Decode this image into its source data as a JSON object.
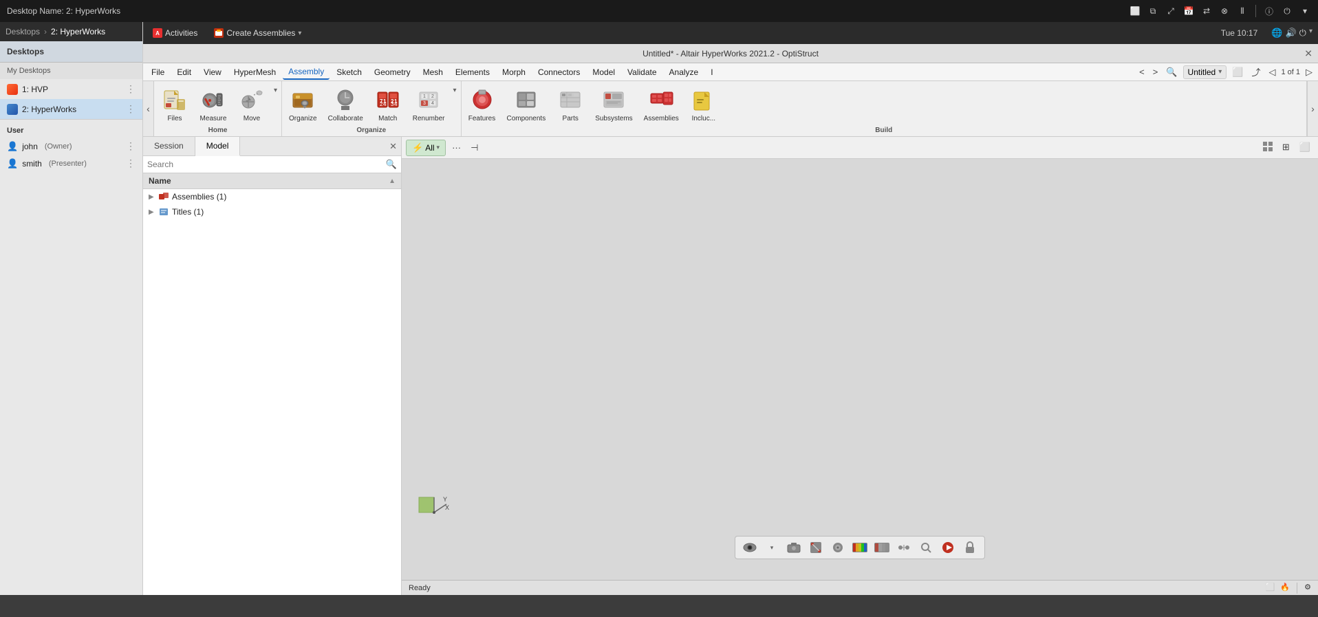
{
  "system_bar": {
    "title": "Desktop Name: 2: HyperWorks",
    "icons": [
      "monitor-icon",
      "copy-icon",
      "resize-icon",
      "calendar-icon",
      "network-icon",
      "cancel-icon",
      "settings-icon",
      "info-icon",
      "power-icon"
    ]
  },
  "desktop_bar": {
    "breadcrumb": "Desktops",
    "arrow": "›",
    "current": "2: HyperWorks"
  },
  "sidebar": {
    "section_label": "Desktops",
    "my_desktops_label": "My Desktops",
    "desktops": [
      {
        "id": "hvp",
        "label": "1: HVP",
        "icon_color": "#ff5533"
      },
      {
        "id": "hyperworks",
        "label": "2: HyperWorks",
        "icon_color": "#4488cc",
        "active": true
      }
    ],
    "user_section_label": "User",
    "users": [
      {
        "name": "john",
        "role": "(Owner)"
      },
      {
        "name": "smith",
        "role": "(Presenter)"
      }
    ]
  },
  "app_bar": {
    "activities_label": "Activities",
    "create_assemblies_label": "Create Assemblies",
    "dropdown_arrow": "▾",
    "clock": "Tue 10:17",
    "network_icon": "🌐",
    "volume_icon": "🔊",
    "power_icon": "⏻",
    "dropdown_icon": "▾"
  },
  "window": {
    "title": "Untitled* - Altair HyperWorks 2021.2 - OptiStruct",
    "close": "✕"
  },
  "menu_bar": {
    "items": [
      "File",
      "Edit",
      "View",
      "HyperMesh",
      "Assembly",
      "Sketch",
      "Geometry",
      "Mesh",
      "Elements",
      "Morph",
      "Connectors",
      "Model",
      "Validate",
      "Analyze",
      "I"
    ],
    "active_item": "Assembly",
    "tab_name": "Untitled",
    "page_info": "1 of 1"
  },
  "ribbon": {
    "groups": [
      {
        "label": "Home",
        "items": [
          {
            "id": "files",
            "label": "Files"
          },
          {
            "id": "measure",
            "label": "Measure"
          },
          {
            "id": "move",
            "label": "Move"
          }
        ]
      },
      {
        "label": "Organize",
        "items": [
          {
            "id": "organize",
            "label": "Organize"
          },
          {
            "id": "collaborate",
            "label": "Collaborate"
          },
          {
            "id": "match",
            "label": "Match"
          },
          {
            "id": "renumber",
            "label": "Renumber"
          }
        ]
      },
      {
        "label": "Build",
        "items": [
          {
            "id": "features",
            "label": "Features"
          },
          {
            "id": "components",
            "label": "Components"
          },
          {
            "id": "parts",
            "label": "Parts"
          },
          {
            "id": "subsystems",
            "label": "Subsystems"
          },
          {
            "id": "assemblies",
            "label": "Assemblies"
          },
          {
            "id": "include",
            "label": "Incluc..."
          }
        ]
      }
    ]
  },
  "panel": {
    "tabs": [
      "Session",
      "Model"
    ],
    "active_tab": "Model",
    "search_placeholder": "Search",
    "close_btn": "✕",
    "tree_header": "Name",
    "tree_items": [
      {
        "label": "Assemblies (1)",
        "icon": "assembly"
      },
      {
        "label": "Titles (1)",
        "icon": "titles"
      }
    ]
  },
  "viewport": {
    "filter_label": "All",
    "filter_icon": "⚡",
    "more_icon": "···",
    "nav_icon": "⊣"
  },
  "status_bar": {
    "status": "Ready",
    "settings_icon": "⚙"
  }
}
